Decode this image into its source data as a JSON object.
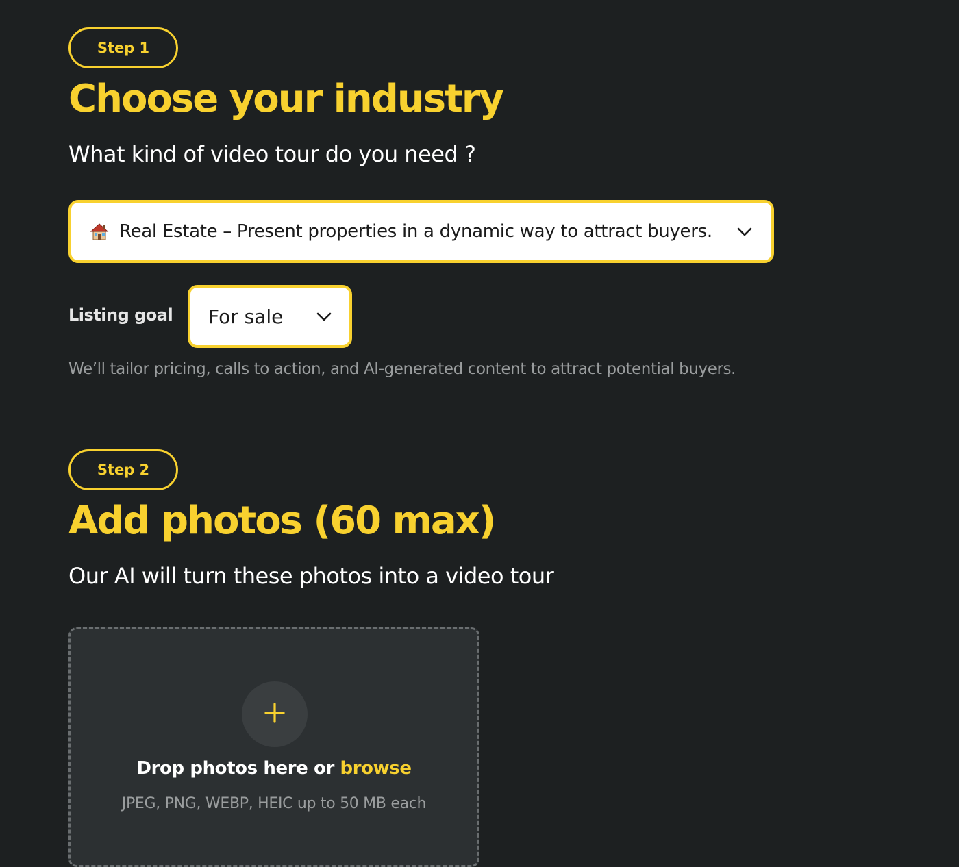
{
  "step1": {
    "badge": "Step 1",
    "title": "Choose your industry",
    "subtitle": "What kind of video tour do you need ?",
    "industry_select": {
      "icon": "house-emoji-icon",
      "selected": "Real Estate – Present properties in a dynamic way to attract buyers."
    },
    "listing_goal": {
      "label": "Listing goal",
      "selected": "For sale"
    },
    "hint": "We’ll tailor pricing, calls to action, and AI-generated content to attract potential buyers."
  },
  "step2": {
    "badge": "Step 2",
    "title": "Add photos (60 max)",
    "subtitle": "Our AI will turn these photos into a video tour",
    "dropzone": {
      "prompt": "Drop photos here or ",
      "browse": "browse",
      "formats": "JPEG, PNG, WEBP, HEIC up to 50 MB each"
    }
  },
  "colors": {
    "background": "#1d2021",
    "accent": "#f8d12f",
    "muted_text": "#9a9d9e",
    "dropzone_bg": "#2c3032"
  }
}
